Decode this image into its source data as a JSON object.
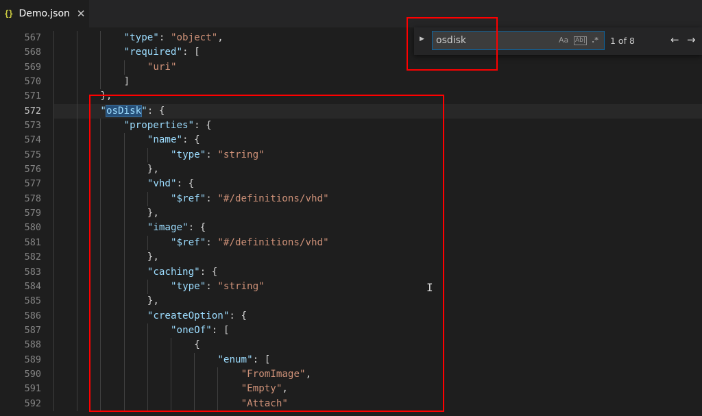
{
  "tab": {
    "icon": "{}",
    "label": "Demo.json",
    "close": "✕"
  },
  "find": {
    "query": "osdisk",
    "match_case": "Aa",
    "whole_word": "Ab|",
    "regex": ".*",
    "count": "1 of 8",
    "prev": "←",
    "next": "→"
  },
  "editor": {
    "active_line": "572",
    "lines": [
      {
        "n": "567",
        "indent": 3,
        "tokens": [
          [
            "k",
            "\"type\""
          ],
          [
            "p",
            ": "
          ],
          [
            "s",
            "\"object\""
          ],
          [
            "p",
            ","
          ]
        ]
      },
      {
        "n": "568",
        "indent": 3,
        "tokens": [
          [
            "k",
            "\"required\""
          ],
          [
            "p",
            ": ["
          ]
        ]
      },
      {
        "n": "569",
        "indent": 4,
        "tokens": [
          [
            "s",
            "\"uri\""
          ]
        ]
      },
      {
        "n": "570",
        "indent": 3,
        "tokens": [
          [
            "p",
            "]"
          ]
        ]
      },
      {
        "n": "571",
        "indent": 2,
        "tokens": [
          [
            "p",
            "},"
          ]
        ]
      },
      {
        "n": "572",
        "indent": 2,
        "tokens": [
          [
            "k",
            "\""
          ],
          [
            "kh",
            "osDisk"
          ],
          [
            "k",
            "\""
          ],
          [
            "p",
            ": {"
          ]
        ]
      },
      {
        "n": "573",
        "indent": 3,
        "tokens": [
          [
            "k",
            "\"properties\""
          ],
          [
            "p",
            ": {"
          ]
        ]
      },
      {
        "n": "574",
        "indent": 4,
        "tokens": [
          [
            "k",
            "\"name\""
          ],
          [
            "p",
            ": {"
          ]
        ]
      },
      {
        "n": "575",
        "indent": 5,
        "tokens": [
          [
            "k",
            "\"type\""
          ],
          [
            "p",
            ": "
          ],
          [
            "s",
            "\"string\""
          ]
        ]
      },
      {
        "n": "576",
        "indent": 4,
        "tokens": [
          [
            "p",
            "},"
          ]
        ]
      },
      {
        "n": "577",
        "indent": 4,
        "tokens": [
          [
            "k",
            "\"vhd\""
          ],
          [
            "p",
            ": {"
          ]
        ]
      },
      {
        "n": "578",
        "indent": 5,
        "tokens": [
          [
            "k",
            "\"$ref\""
          ],
          [
            "p",
            ": "
          ],
          [
            "s",
            "\"#/definitions/vhd\""
          ]
        ]
      },
      {
        "n": "579",
        "indent": 4,
        "tokens": [
          [
            "p",
            "},"
          ]
        ]
      },
      {
        "n": "580",
        "indent": 4,
        "tokens": [
          [
            "k",
            "\"image\""
          ],
          [
            "p",
            ": {"
          ]
        ]
      },
      {
        "n": "581",
        "indent": 5,
        "tokens": [
          [
            "k",
            "\"$ref\""
          ],
          [
            "p",
            ": "
          ],
          [
            "s",
            "\"#/definitions/vhd\""
          ]
        ]
      },
      {
        "n": "582",
        "indent": 4,
        "tokens": [
          [
            "p",
            "},"
          ]
        ]
      },
      {
        "n": "583",
        "indent": 4,
        "tokens": [
          [
            "k",
            "\"caching\""
          ],
          [
            "p",
            ": {"
          ]
        ]
      },
      {
        "n": "584",
        "indent": 5,
        "tokens": [
          [
            "k",
            "\"type\""
          ],
          [
            "p",
            ": "
          ],
          [
            "s",
            "\"string\""
          ]
        ]
      },
      {
        "n": "585",
        "indent": 4,
        "tokens": [
          [
            "p",
            "},"
          ]
        ]
      },
      {
        "n": "586",
        "indent": 4,
        "tokens": [
          [
            "k",
            "\"createOption\""
          ],
          [
            "p",
            ": {"
          ]
        ]
      },
      {
        "n": "587",
        "indent": 5,
        "tokens": [
          [
            "k",
            "\"oneOf\""
          ],
          [
            "p",
            ": ["
          ]
        ]
      },
      {
        "n": "588",
        "indent": 6,
        "tokens": [
          [
            "p",
            "{"
          ]
        ]
      },
      {
        "n": "589",
        "indent": 7,
        "tokens": [
          [
            "k",
            "\"enum\""
          ],
          [
            "p",
            ": ["
          ]
        ]
      },
      {
        "n": "590",
        "indent": 8,
        "tokens": [
          [
            "s",
            "\"FromImage\""
          ],
          [
            "p",
            ","
          ]
        ]
      },
      {
        "n": "591",
        "indent": 8,
        "tokens": [
          [
            "s",
            "\"Empty\""
          ],
          [
            "p",
            ","
          ]
        ]
      },
      {
        "n": "592",
        "indent": 8,
        "tokens": [
          [
            "s",
            "\"Attach\""
          ]
        ]
      }
    ]
  },
  "colors": {
    "background": "#1e1e1e",
    "key": "#9cdcfe",
    "string": "#ce9178",
    "annotation": "#ff0000",
    "find_border": "#0e639c"
  }
}
